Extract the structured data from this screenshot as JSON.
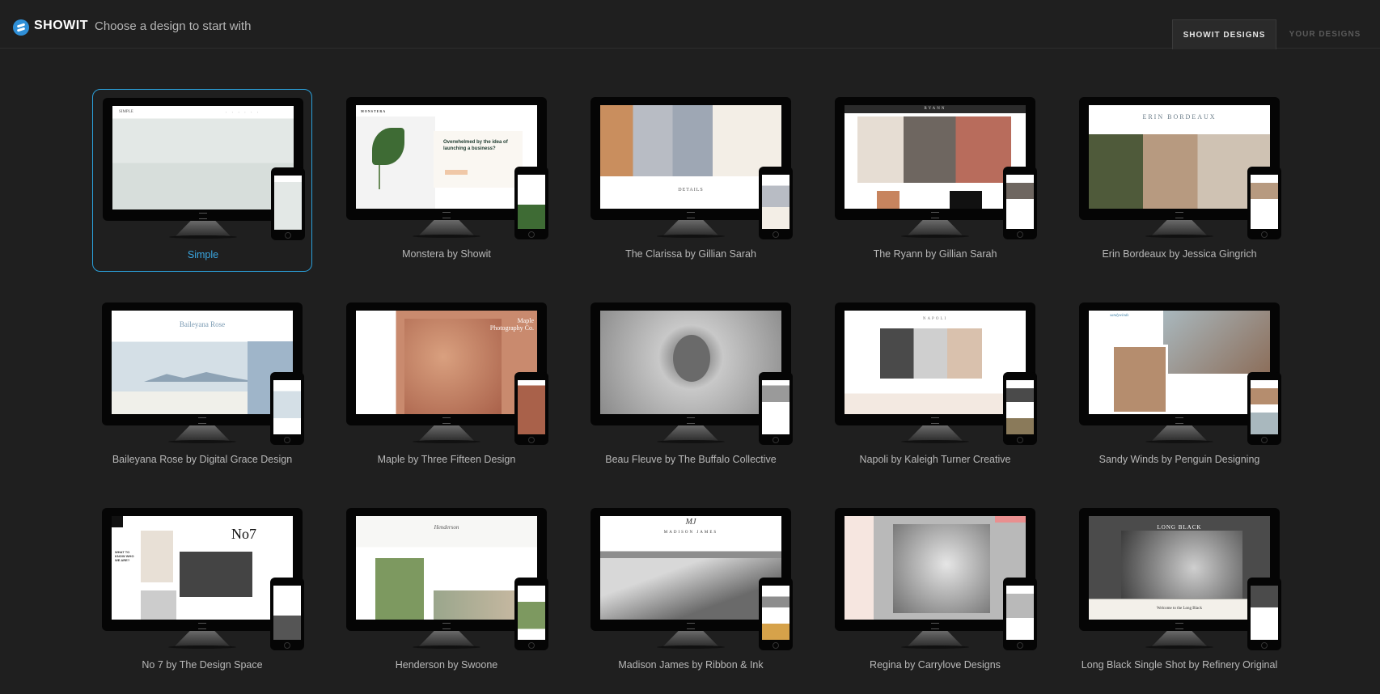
{
  "header": {
    "brand": "SHOWIT",
    "subtitle": "Choose a design to start with",
    "tabs": [
      {
        "label": "SHOWIT DESIGNS",
        "active": true
      },
      {
        "label": "YOUR DESIGNS",
        "active": false
      }
    ]
  },
  "colors": {
    "accent": "#2b9fd9",
    "background": "#1f1f1f"
  },
  "designs": [
    {
      "label": "Simple",
      "selected": true,
      "site_name": "SIMPLE"
    },
    {
      "label": "Monstera by Showit",
      "selected": false,
      "site_name": "MONSTERA",
      "headline": "Overwhelmed by the idea of launching a business?"
    },
    {
      "label": "The Clarissa by Gillian Sarah",
      "selected": false,
      "site_name": "DETAILS"
    },
    {
      "label": "The Ryann by Gillian Sarah",
      "selected": false,
      "site_name": "RYANN"
    },
    {
      "label": "Erin Bordeaux by Jessica Gingrich",
      "selected": false,
      "site_name": "ERIN BORDEAUX"
    },
    {
      "label": "Baileyana Rose by Digital Grace Design",
      "selected": false,
      "site_name": "Baileyana Rose"
    },
    {
      "label": "Maple by Three Fifteen Design",
      "selected": false,
      "site_name": "Maple Photography Co."
    },
    {
      "label": "Beau Fleuve by The Buffalo Collective",
      "selected": false,
      "site_name": ""
    },
    {
      "label": "Napoli by Kaleigh Turner Creative",
      "selected": false,
      "site_name": "NAPOLI"
    },
    {
      "label": "Sandy Winds by Penguin Designing",
      "selected": false,
      "site_name": "sandywinds"
    },
    {
      "label": "No 7 by The Design Space",
      "selected": false,
      "site_name": "No7",
      "headline": "WHAT TO KNOW WHO WE ARE?"
    },
    {
      "label": "Henderson by Swoone",
      "selected": false,
      "site_name": "Henderson"
    },
    {
      "label": "Madison James by Ribbon & Ink",
      "selected": false,
      "site_name": "MADISON JAMES",
      "monogram": "MJ"
    },
    {
      "label": "Regina by Carrylove Designs",
      "selected": false,
      "site_name": ""
    },
    {
      "label": "Long Black Single Shot by Refinery Original",
      "selected": false,
      "site_name": "LONG BLACK",
      "headline": "Welcome to the Long Black"
    }
  ]
}
